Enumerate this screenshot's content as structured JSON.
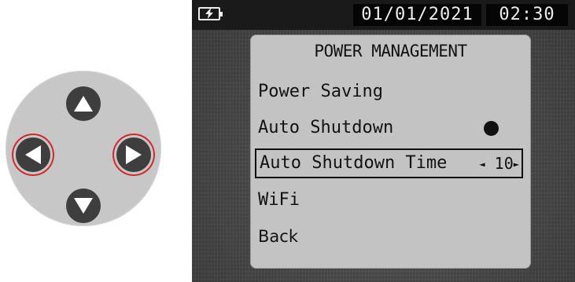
{
  "status_bar": {
    "date": "01/01/2021",
    "time": "02:30",
    "battery_icon": "battery-charging-icon"
  },
  "menu": {
    "title": "POWER MANAGEMENT",
    "items": [
      {
        "label": "Power Saving"
      },
      {
        "label": "Auto Shutdown",
        "toggle_state": "on"
      },
      {
        "label": "Auto Shutdown Time",
        "value": "10",
        "selected": true
      },
      {
        "label": "WiFi"
      },
      {
        "label": "Back"
      }
    ]
  },
  "dpad": {
    "buttons": [
      "up",
      "down",
      "left",
      "right"
    ],
    "highlighted": [
      "left",
      "right"
    ],
    "highlight_color": "#d22a2a"
  }
}
